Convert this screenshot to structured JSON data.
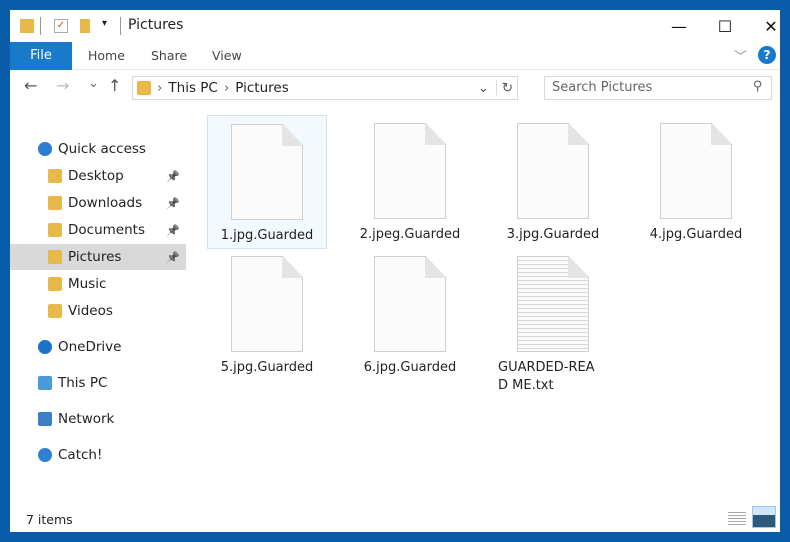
{
  "window": {
    "title": "Pictures",
    "minimize": "—",
    "maximize": "☐",
    "close": "✕"
  },
  "ribbon": {
    "tabs": [
      "File",
      "Home",
      "Share",
      "View"
    ],
    "expand": "﹀",
    "help": "?"
  },
  "address": {
    "back": "←",
    "forward": "→",
    "recent": "⌄",
    "up": "↑",
    "crumbs": [
      "This PC",
      "Pictures"
    ],
    "sep": "›",
    "dropdown": "⌄",
    "refresh": "↻"
  },
  "search": {
    "placeholder": "Search Pictures",
    "icon": "⚲"
  },
  "sidebar": {
    "items": [
      {
        "label": "Quick access",
        "icon": "star-icon",
        "color": "#2b7cd3"
      },
      {
        "label": "Desktop",
        "icon": "folder-icon",
        "color": "#e8b84a",
        "pinned": true
      },
      {
        "label": "Downloads",
        "icon": "folder-icon",
        "color": "#e8b84a",
        "pinned": true
      },
      {
        "label": "Documents",
        "icon": "folder-icon",
        "color": "#e8b84a",
        "pinned": true
      },
      {
        "label": "Pictures",
        "icon": "folder-icon",
        "color": "#e8b84a",
        "pinned": true,
        "selected": true
      },
      {
        "label": "Music",
        "icon": "folder-icon",
        "color": "#e8b84a"
      },
      {
        "label": "Videos",
        "icon": "folder-icon",
        "color": "#e8b84a"
      },
      {
        "label": "OneDrive",
        "icon": "cloud-icon",
        "color": "#1a73c9"
      },
      {
        "label": "This PC",
        "icon": "computer-icon",
        "color": "#4a9ad8"
      },
      {
        "label": "Network",
        "icon": "network-icon",
        "color": "#3b7fc4"
      },
      {
        "label": "Catch!",
        "icon": "catch-icon",
        "color": "#2f80d0"
      }
    ]
  },
  "files": [
    {
      "name": "1.jpg.Guarded",
      "type": "blank"
    },
    {
      "name": "2.jpeg.Guarded",
      "type": "blank"
    },
    {
      "name": "3.jpg.Guarded",
      "type": "blank"
    },
    {
      "name": "4.jpg.Guarded",
      "type": "blank"
    },
    {
      "name": "5.jpg.Guarded",
      "type": "blank"
    },
    {
      "name": "6.jpg.Guarded",
      "type": "blank"
    },
    {
      "name": "GUARDED-READ ME.txt",
      "type": "text"
    }
  ],
  "status": {
    "count": "7 items"
  }
}
